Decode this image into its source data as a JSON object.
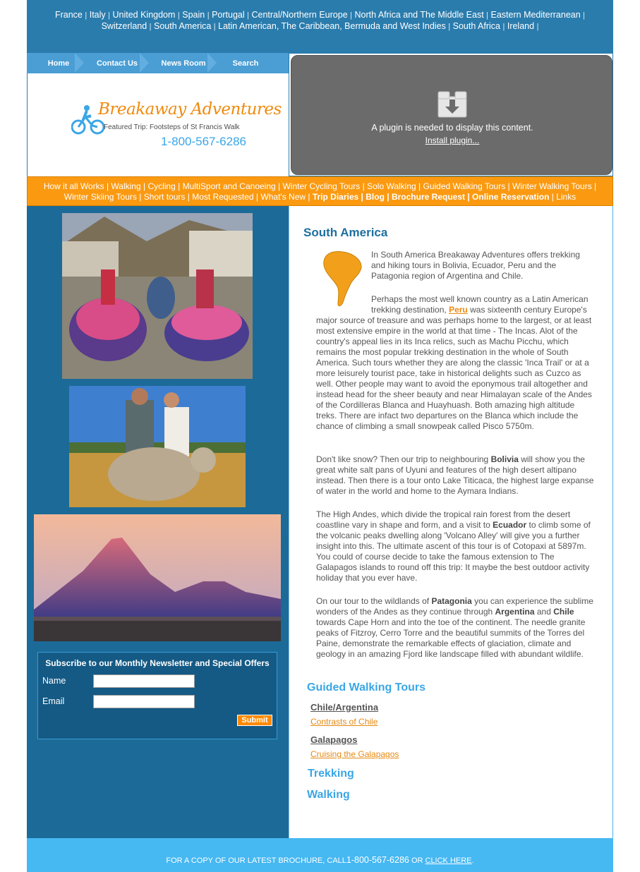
{
  "top_nav": {
    "items": [
      "France",
      "Italy",
      "United Kingdom",
      "Spain",
      "Portugal",
      "Central/Northern Europe",
      "North Africa and The Middle East",
      "Eastern Mediterranean",
      "Switzerland",
      "South America",
      "Latin American, The Caribbean, Bermuda and West Indies",
      "South Africa",
      "Ireland"
    ],
    "separator": "|"
  },
  "tabs": [
    "Home",
    "Contact Us",
    "News Room",
    "Search"
  ],
  "logo": {
    "brand": "Breakaway Adventures",
    "featured": "Featured Trip: Footsteps of St Francis Walk",
    "phone": "1-800-567-6286"
  },
  "plugin": {
    "message": "A plugin is needed to display this content.",
    "link": "Install plugin..."
  },
  "category_nav": {
    "row1": [
      "How it all Works",
      "Walking",
      "Cycling",
      "MultiSport and Canoeing",
      "Winter Cycling Tours",
      "Solo Walking",
      "Guided Walking Tours",
      "Winter Walking Tours"
    ],
    "row2": [
      "Winter Skiing Tours",
      "Short tours",
      "Most Requested",
      "What's New",
      "Trip Diaries",
      "Blog",
      "Brochure Request",
      "Online Reservation",
      "Links"
    ]
  },
  "newsletter": {
    "title": "Subscribe to our Monthly Newsletter and Special Offers",
    "name_label": "Name",
    "email_label": "Email",
    "submit": "Submit"
  },
  "main": {
    "title": "South America",
    "p1": "In South America Breakaway Adventures offers trekking and hiking tours in Bolivia, Ecuador, Peru and the Patagonia region of Argentina and Chile.",
    "p2_lead": "Perhaps the  most well known country as a Latin American trekking destination,",
    "p2_link": "Peru",
    "p2_rest": "was sixteenth century Europe's major source of treasure and was perhaps home to the largest, or at least most extensive empire in the world at that time - The Incas. Alot of the country's appeal lies in its Inca relics, such as  Machu Picchu, which remains the most popular trekking destination in the whole of South America. Such tours whether they are along the classic 'Inca Trail' or at a more leisurely tourist pace, take in historical delights such as Cuzco as well. Other people may want to avoid the eponymous trail altogether and instead head for the sheer beauty and near Himalayan scale of the Andes of the Cordilleras Blanca and Huayhuash. Both amazing high altitude treks. There are infact two departures on the Blanca which include the  chance of climbing a small snowpeak called Pisco 5750m.",
    "p3_a": "Don't like snow? Then our trip to neighbouring",
    "p3_b": "Bolivia",
    "p3_c": "will show you the great white salt pans of Uyuni and features of the high desert altipano instead. Then there is a tour onto Lake Titicaca, the highest large expanse of water in the world and home to the Aymara Indians.",
    "p4_a": "The High Andes, which divide the tropical rain forest from the desert coastline vary in shape and form, and a visit to",
    "p4_b": "Ecuador",
    "p4_c": "to climb some of the volcanic  peaks dwelling along 'Volcano Alley' will give you a further insight into this. The ultimate ascent  of this tour is of Cotopaxi at 5897m.  You could of course decide to take the famous extension to The Galapagos islands to round off this trip: It maybe the best outdoor activity holiday that you ever have.",
    "p5_a": "On our tour to the wildlands of",
    "p5_b": "Patagonia",
    "p5_c": "you can experience the sublime wonders of the Andes as they continue through",
    "p5_d": "Argentina",
    "p5_e": "and",
    "p5_f": "Chile",
    "p5_g": "towards Cape Horn and into the toe of the continent. The needle granite peaks of  Fitzroy, Cerro Torre and the beautiful summits of the Torres del Paine,  demonstrate  the remarkable effects of glaciation, climate and geology in an amazing Fjord like landscape  filled with abundant wildlife.",
    "guided_heading": "Guided Walking Tours",
    "sub1_heading": "Chile/Argentina",
    "sub1_link": "Contrasts of Chile",
    "sub2_heading": "Galapagos",
    "sub2_link": "Cruising the Galapagos",
    "trekking_heading": "Trekking",
    "walking_heading": "Walking"
  },
  "footer": {
    "lead": "FOR A COPY OF OUR LATEST BROCHURE, CALL",
    "phone": "1-800-567-6286",
    "mid": "OR",
    "link": "CLICK HERE",
    "tail": "."
  },
  "colors": {
    "top_blue": "#2a7cad",
    "orange": "#fb9a11",
    "left_panel": "#1c6a98",
    "footer": "#46b8f2",
    "heading": "#1e6fa0"
  }
}
